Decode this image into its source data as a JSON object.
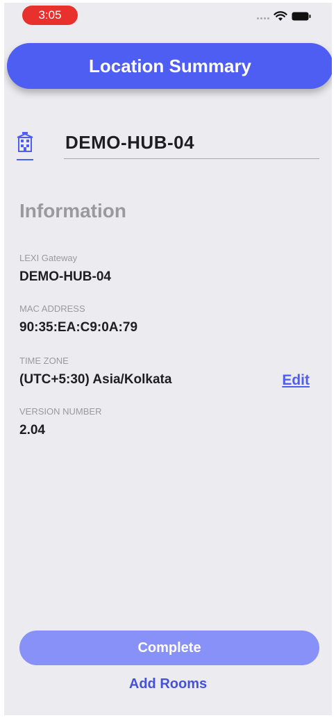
{
  "status_bar": {
    "time": "3:05",
    "icons": [
      "signal-dots-icon",
      "wifi-icon",
      "battery-icon"
    ]
  },
  "header": {
    "title": "Location Summary"
  },
  "location": {
    "icon": "house-icon",
    "name": "DEMO-HUB-04"
  },
  "information": {
    "heading": "Information",
    "fields": [
      {
        "label": "LEXI Gateway",
        "value": "DEMO-HUB-04"
      },
      {
        "label": "MAC ADDRESS",
        "value": "90:35:EA:C9:0A:79"
      },
      {
        "label": "TIME ZONE",
        "value": "(UTC+5:30) Asia/Kolkata"
      },
      {
        "label": "VERSION NUMBER",
        "value": "2.04"
      }
    ],
    "edit_label": "Edit"
  },
  "actions": {
    "complete_label": "Complete",
    "add_rooms_label": "Add Rooms"
  },
  "colors": {
    "accent": "#4e5ef2",
    "button_disabled": "#8791f7",
    "status_time_bg": "#e8302c",
    "background": "#ecebef"
  }
}
